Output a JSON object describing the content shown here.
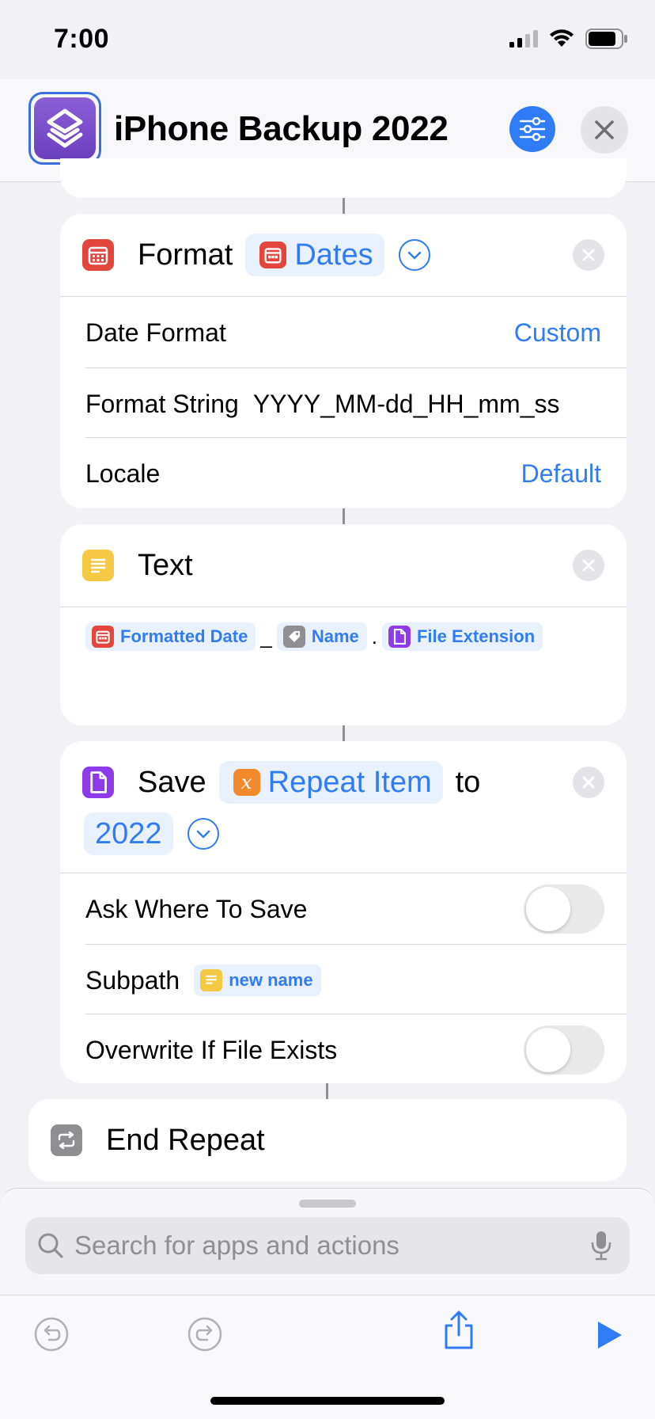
{
  "status_bar": {
    "time": "7:00"
  },
  "header": {
    "title": "iPhone Backup 2022"
  },
  "format_action": {
    "verb": "Format",
    "token": "Dates",
    "rows": [
      {
        "label": "Date Format",
        "value": "Custom"
      },
      {
        "label": "Format String",
        "value": "YYYY_MM-dd_HH_mm_ss"
      },
      {
        "label": "Locale",
        "value": "Default"
      }
    ]
  },
  "text_action": {
    "verb": "Text",
    "tokens": [
      {
        "label": "Formatted Date",
        "icon": "calendar-icon"
      },
      {
        "label": "Name",
        "icon": "tag-icon"
      },
      {
        "label": "File Extension",
        "icon": "document-icon"
      }
    ],
    "separators": [
      "_",
      "."
    ]
  },
  "save_action": {
    "verb": "Save",
    "token": "Repeat Item",
    "token_glyph": "x",
    "connector": "to",
    "folder": "2022",
    "rows": [
      {
        "label": "Ask Where To Save",
        "toggle": false
      },
      {
        "label": "Subpath",
        "token": "new name"
      },
      {
        "label": "Overwrite If File Exists",
        "toggle": false
      }
    ]
  },
  "end_repeat": {
    "label": "End Repeat"
  },
  "search": {
    "placeholder": "Search for apps and actions"
  },
  "colors": {
    "accent": "#2f7cf6",
    "format_icon": "#e2463c",
    "text_icon": "#f6c945",
    "save_icon": "#8e3ae8",
    "variable_icon": "#f18a2d",
    "repeat_icon": "#8e8e93"
  }
}
